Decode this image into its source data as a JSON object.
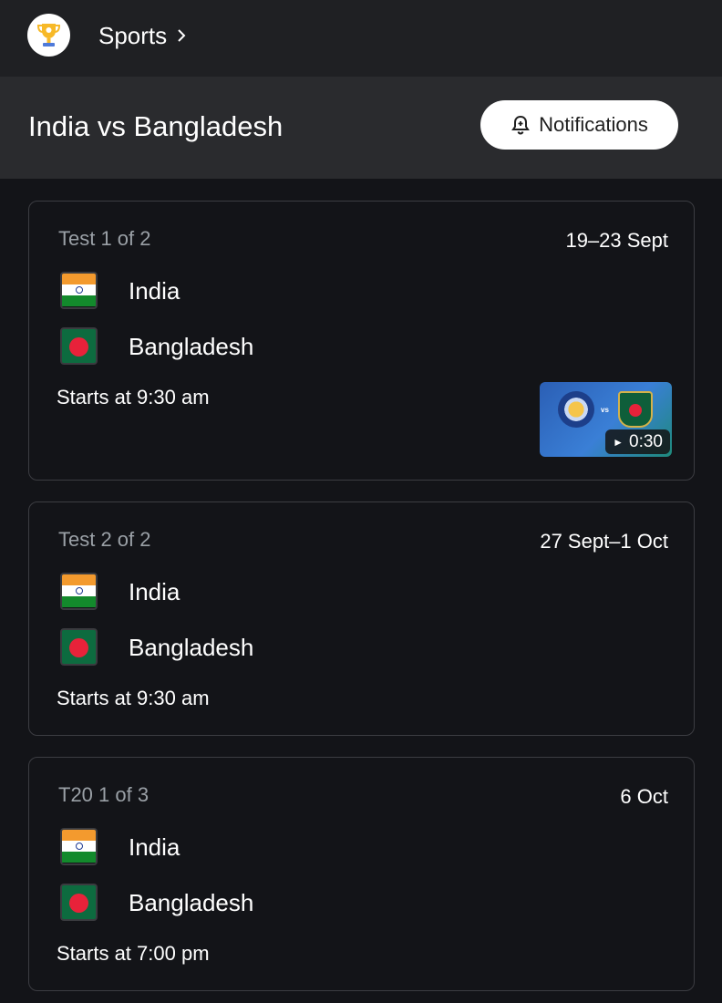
{
  "topbar": {
    "section": "Sports",
    "icon": "trophy-icon"
  },
  "header": {
    "title": "India vs Bangladesh",
    "notifications_label": "Notifications"
  },
  "matches": [
    {
      "label": "Test 1 of 2",
      "date": "19–23 Sept",
      "team1": "India",
      "team2": "Bangladesh",
      "starts": "Starts at 9:30 am",
      "video": {
        "duration": "0:30",
        "vs_text": "vs"
      }
    },
    {
      "label": "Test 2 of 2",
      "date": "27 Sept–1 Oct",
      "team1": "India",
      "team2": "Bangladesh",
      "starts": "Starts at 9:30 am"
    },
    {
      "label": "T20 1 of 3",
      "date": "6 Oct",
      "team1": "India",
      "team2": "Bangladesh",
      "starts": "Starts at 7:00 pm"
    }
  ],
  "colors": {
    "background": "#131418",
    "topbar": "#1f2023",
    "header": "#2a2b2e",
    "card_border": "#3c3d42",
    "muted_text": "#9aa0a6"
  }
}
